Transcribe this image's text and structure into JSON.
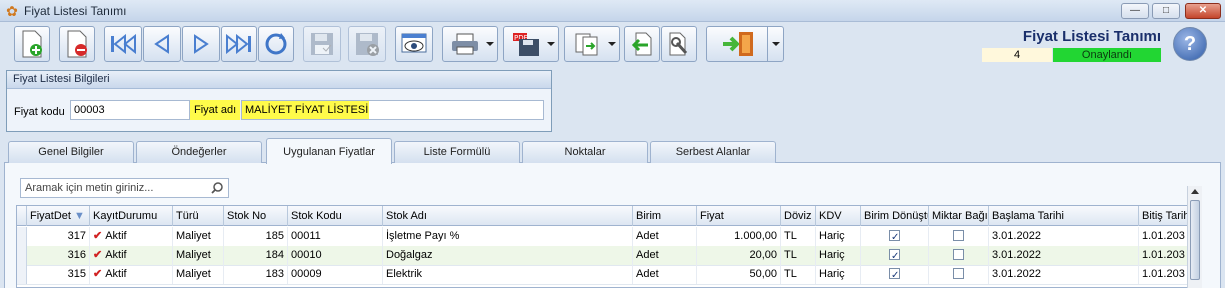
{
  "window": {
    "title": "Fiyat Listesi Tanımı",
    "minimize": "—",
    "maximize": "□",
    "close": "✕"
  },
  "header": {
    "title": "Fiyat Listesi Tanımı",
    "record_count": "4",
    "status": "Onaylandı",
    "help": "?"
  },
  "info": {
    "section_title": "Fiyat Listesi Bilgileri",
    "code_label": "Fiyat kodu",
    "code_value": "00003",
    "name_label": "Fiyat adı",
    "name_value": "MALİYET FİYAT LİSTESİ"
  },
  "tabs": [
    {
      "label": "Genel Bilgiler"
    },
    {
      "label": "Öndeğerler"
    },
    {
      "label": "Uygulanan Fiyatlar"
    },
    {
      "label": "Liste Formülü"
    },
    {
      "label": "Noktalar"
    },
    {
      "label": "Serbest Alanlar"
    }
  ],
  "search": {
    "placeholder": "Aramak için metin giriniz..."
  },
  "grid": {
    "columns": [
      "FiyatDet",
      "KayıtDurumu",
      "Türü",
      "Stok No",
      "Stok Kodu",
      "Stok Adı",
      "Birim",
      "Fiyat",
      "Döviz",
      "KDV",
      "Birim Dönüştü",
      "Miktar Bağım",
      "Başlama Tarihi",
      "Bitiş Tarih"
    ],
    "rows": [
      {
        "fiyatdet": "317",
        "durum": "Aktif",
        "turu": "Maliyet",
        "stokno": "185",
        "stokkodu": "00011",
        "stokadi": "İşletme Payı %",
        "birim": "Adet",
        "fiyat": "1.000,00",
        "doviz": "TL",
        "kdv": "Hariç",
        "birim_donustur": true,
        "miktar_bagimli": false,
        "baslama": "3.01.2022",
        "bitis": "1.01.203"
      },
      {
        "fiyatdet": "316",
        "durum": "Aktif",
        "turu": "Maliyet",
        "stokno": "184",
        "stokkodu": "00010",
        "stokadi": "Doğalgaz",
        "birim": "Adet",
        "fiyat": "20,00",
        "doviz": "TL",
        "kdv": "Hariç",
        "birim_donustur": true,
        "miktar_bagimli": false,
        "baslama": "3.01.2022",
        "bitis": "1.01.203"
      },
      {
        "fiyatdet": "315",
        "durum": "Aktif",
        "turu": "Maliyet",
        "stokno": "183",
        "stokkodu": "00009",
        "stokadi": "Elektrik",
        "birim": "Adet",
        "fiyat": "50,00",
        "doviz": "TL",
        "kdv": "Hariç",
        "birim_donustur": true,
        "miktar_bagimli": false,
        "baslama": "3.01.2022",
        "bitis": "1.01.203"
      }
    ]
  },
  "colors": {
    "status_green": "#22d633",
    "highlight": "#fffb4a",
    "title_blue": "#1a2f6b"
  }
}
